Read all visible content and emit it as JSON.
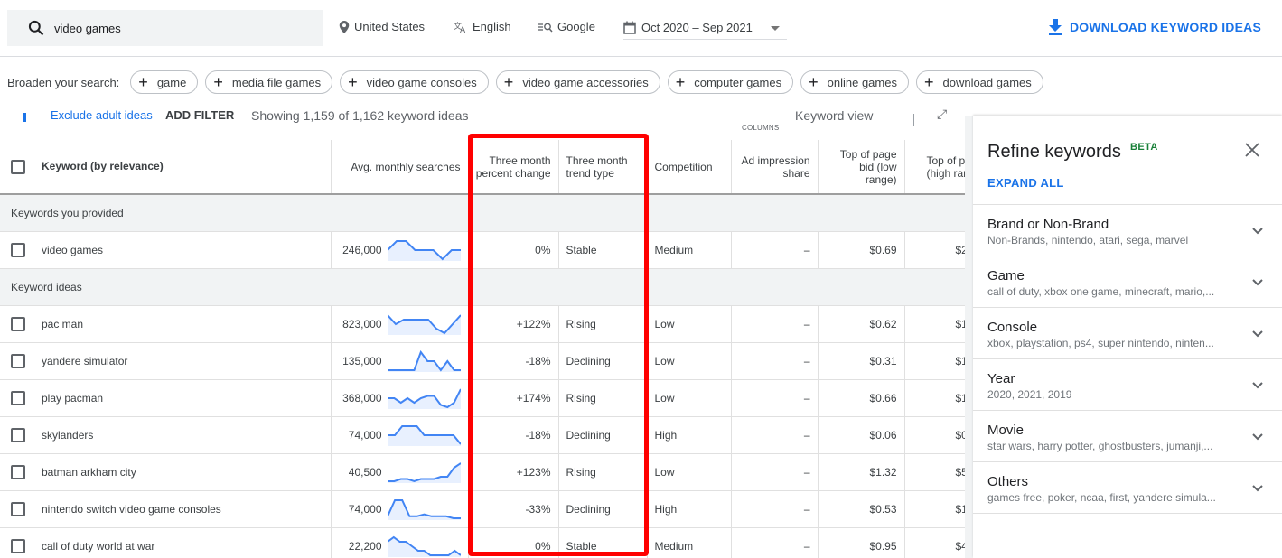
{
  "topbar": {
    "search_value": "video games",
    "location": "United States",
    "language": "English",
    "network": "Google",
    "date_range": "Oct 2020 – Sep 2021",
    "download_label": "DOWNLOAD KEYWORD IDEAS"
  },
  "broaden": {
    "label": "Broaden your search:",
    "chips": [
      "game",
      "media file games",
      "video game consoles",
      "video game accessories",
      "computer games",
      "online games",
      "download games"
    ]
  },
  "filters": {
    "exclude_adult": "Exclude adult ideas",
    "add_filter": "ADD FILTER",
    "showing": "Showing 1,159 of 1,162 keyword ideas",
    "columns": "COLUMNS",
    "keyword_view": "Keyword view"
  },
  "table": {
    "headers": {
      "keyword": "Keyword (by relevance)",
      "searches": "Avg. monthly searches",
      "three_month_change": "Three month percent change",
      "three_month_trend": "Three month trend type",
      "competition": "Competition",
      "ad_impression": "Ad impression share",
      "bid_low": "Top of page bid (low range)",
      "bid_high": "Top of page bid (high range)"
    },
    "sections": {
      "provided": "Keywords you provided",
      "ideas": "Keyword ideas"
    },
    "provided_rows": [
      {
        "keyword": "video games",
        "searches": "246,000",
        "change": "0%",
        "trend": "Stable",
        "competition": "Medium",
        "impression": "–",
        "bid_low": "$0.69",
        "bid_high": "$2",
        "spark": [
          2,
          4,
          4,
          2,
          2,
          2,
          0,
          2,
          2
        ]
      }
    ],
    "idea_rows": [
      {
        "keyword": "pac man",
        "searches": "823,000",
        "change": "+122%",
        "trend": "Rising",
        "competition": "Low",
        "impression": "–",
        "bid_low": "$0.62",
        "bid_high": "$1",
        "spark": [
          4,
          2,
          3,
          3,
          3,
          3,
          1,
          0,
          2,
          4
        ]
      },
      {
        "keyword": "yandere simulator",
        "searches": "135,000",
        "change": "-18%",
        "trend": "Declining",
        "competition": "Low",
        "impression": "–",
        "bid_low": "$0.31",
        "bid_high": "$1",
        "spark": [
          0,
          0,
          0,
          0,
          0,
          4,
          2,
          2,
          0,
          2,
          0,
          0
        ]
      },
      {
        "keyword": "play pacman",
        "searches": "368,000",
        "change": "+174%",
        "trend": "Rising",
        "competition": "Low",
        "impression": "–",
        "bid_low": "$0.66",
        "bid_high": "$1",
        "spark": [
          3,
          3,
          2,
          3,
          2,
          3,
          3.5,
          3.5,
          1.5,
          1,
          2,
          5
        ]
      },
      {
        "keyword": "skylanders",
        "searches": "74,000",
        "change": "-18%",
        "trend": "Declining",
        "competition": "High",
        "impression": "–",
        "bid_low": "$0.06",
        "bid_high": "$0",
        "spark": [
          2,
          2,
          4,
          4,
          4,
          2,
          2,
          2,
          2,
          2,
          0
        ]
      },
      {
        "keyword": "batman arkham city",
        "searches": "40,500",
        "change": "+123%",
        "trend": "Rising",
        "competition": "Low",
        "impression": "–",
        "bid_low": "$1.32",
        "bid_high": "$5",
        "spark": [
          0,
          0,
          0.5,
          0.5,
          0,
          0.5,
          0.5,
          0.5,
          1,
          1,
          3,
          4
        ]
      },
      {
        "keyword": "nintendo switch video game consoles",
        "searches": "74,000",
        "change": "-33%",
        "trend": "Declining",
        "competition": "High",
        "impression": "–",
        "bid_low": "$0.53",
        "bid_high": "$1",
        "spark": [
          1,
          5,
          5,
          1,
          1,
          1.5,
          1,
          1,
          1,
          0.5,
          0.5
        ]
      },
      {
        "keyword": "call of duty world at war",
        "searches": "22,200",
        "change": "0%",
        "trend": "Stable",
        "competition": "Medium",
        "impression": "–",
        "bid_low": "$0.95",
        "bid_high": "$4",
        "spark": [
          4,
          5,
          4,
          4,
          3,
          2,
          2,
          1,
          1,
          1,
          1,
          2,
          1
        ]
      }
    ]
  },
  "refine": {
    "title": "Refine keywords",
    "badge": "BETA",
    "expand_all": "EXPAND ALL",
    "groups": [
      {
        "name": "Brand or Non-Brand",
        "sub": "Non-Brands, nintendo, atari, sega, marvel"
      },
      {
        "name": "Game",
        "sub": "call of duty, xbox one game, minecraft, mario,..."
      },
      {
        "name": "Console",
        "sub": "xbox, playstation, ps4, super nintendo, ninten..."
      },
      {
        "name": "Year",
        "sub": "2020, 2021, 2019"
      },
      {
        "name": "Movie",
        "sub": "star wars, harry potter, ghostbusters, jumanji,..."
      },
      {
        "name": "Others",
        "sub": "games free, poker, ncaa, first, yandere simula..."
      }
    ]
  },
  "colors": {
    "accent": "#1a73e8",
    "beta": "#188038",
    "highlight": "#ff0000",
    "spark_line": "#4285f4",
    "spark_fill": "#e8f0fe"
  }
}
